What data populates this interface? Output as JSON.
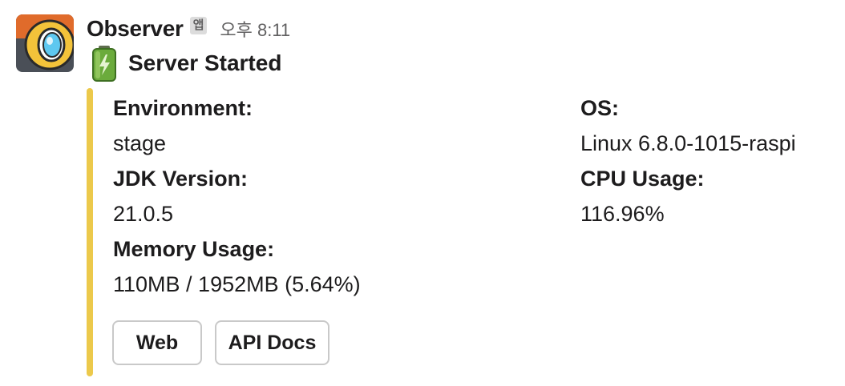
{
  "message": {
    "bot_name": "Observer",
    "app_badge": "앱",
    "timestamp": "오후 8:11",
    "avatar_icon": "observer-bot-avatar",
    "title_icon": "battery-icon",
    "title": "Server Started"
  },
  "attachment": {
    "accent_color": "#ECC94B",
    "fields": {
      "environment": {
        "label": "Environment:",
        "value": "stage"
      },
      "os": {
        "label": "OS:",
        "value": "Linux 6.8.0-1015-raspi"
      },
      "jdk": {
        "label": "JDK Version:",
        "value": "21.0.5"
      },
      "cpu": {
        "label": "CPU Usage:",
        "value": "116.96%"
      },
      "memory": {
        "label": "Memory Usage:",
        "value": "110MB / 1952MB (5.64%)"
      }
    },
    "buttons": {
      "web": "Web",
      "api_docs": "API Docs"
    }
  }
}
